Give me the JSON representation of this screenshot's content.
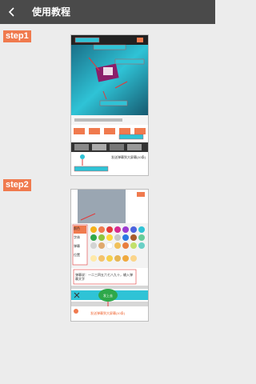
{
  "header": {
    "title": "使用教程",
    "back_icon": "chevron-left-icon",
    "background": "#4a4a4a"
  },
  "steps": [
    {
      "label": "step1"
    },
    {
      "label": "step2"
    }
  ],
  "step1_shot": {
    "action_buttons": [
      "弹幕",
      "弹幕",
      "弹幕",
      "弹幕",
      "弹幕"
    ],
    "footer_text": "发送弹幕到大屏幕(10条)"
  },
  "step2_shot": {
    "menu_items": [
      "颜色",
      "字体",
      "弹幕",
      "位置"
    ],
    "input_text": "弹幕说：一二三四五六七八九十，输入弹幕文字",
    "send_label": "发上去",
    "footer_text": "发送弹幕到大屏幕(10条)"
  },
  "colors": {
    "accent": "#f07a4e",
    "highlight": "#2fc3d6",
    "arrow": "#e23a3a",
    "send": "#2ea84a"
  }
}
